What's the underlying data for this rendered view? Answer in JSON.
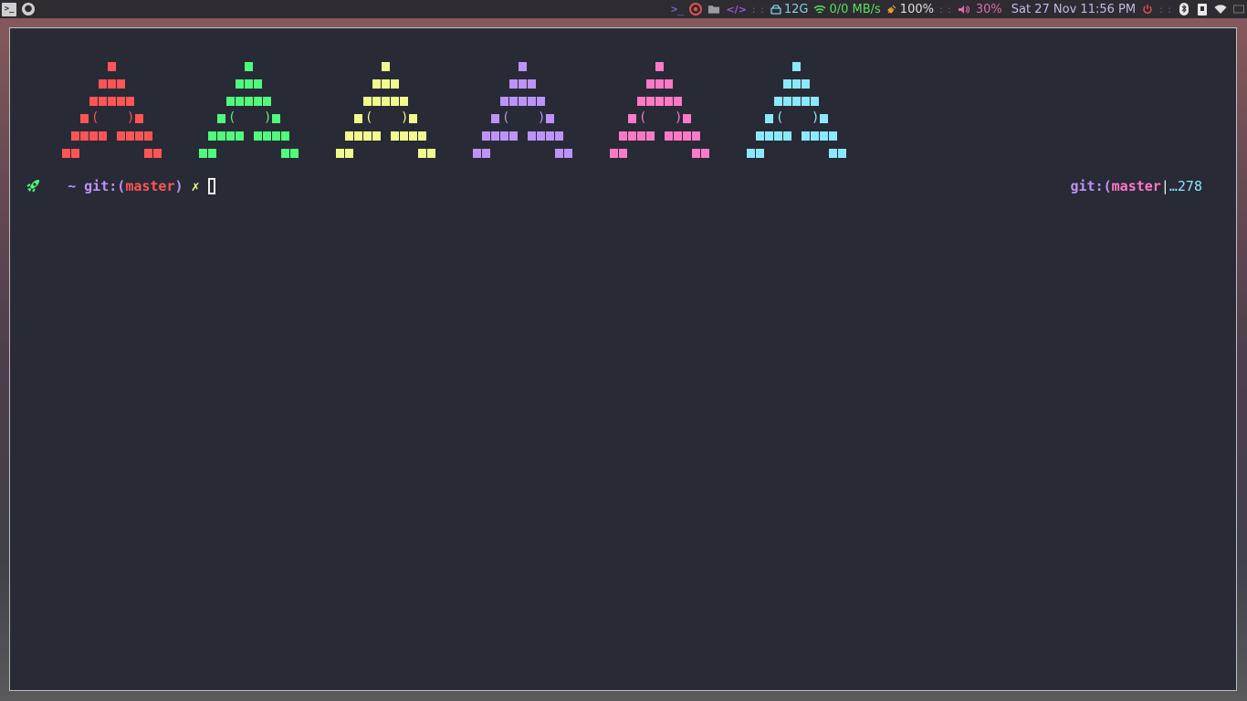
{
  "topbar": {
    "left": {
      "terminal_icon": "terminal-icon",
      "app_icon": "firefox-icon"
    },
    "right": {
      "launchers": {
        "terminal": ">_",
        "chrome": "chrome-icon",
        "files": "folder-icon",
        "code": "</>"
      },
      "separators": [
        ": :",
        ": :",
        ": :",
        ": :"
      ],
      "disk": "12G",
      "network": "0/0 MB/s",
      "battery": "100%",
      "volume": "30%",
      "datetime": "Sat 27 Nov 11:56 PM",
      "tray": [
        "bluetooth-icon",
        "keepassxc-icon",
        "wifi-icon",
        "display-icon"
      ]
    },
    "colors": {
      "launcher_terminal": "#7a7ae6",
      "chrome": "#e05050",
      "code": "#9a5ad8",
      "disk": "#7fd6e6",
      "network": "#5be05b",
      "battery": "#e0e0e0",
      "volume": "#e06aa8",
      "datetime": "#c8b8e8",
      "power": "#e05050"
    }
  },
  "terminal": {
    "invaders": [
      {
        "color": "#ff5555"
      },
      {
        "color": "#50fa7b"
      },
      {
        "color": "#f1fa8c"
      },
      {
        "color": "#bd93f9"
      },
      {
        "color": "#ff79c6"
      },
      {
        "color": "#8be9fd"
      }
    ],
    "eye_left": "(",
    "eye_right": ")",
    "prompt": {
      "symbol_icon": "rocket-icon",
      "tilde": "~",
      "git_label": "git:(",
      "branch": "master",
      "git_close": ")",
      "dirty_mark": "✗"
    },
    "right_prompt": {
      "git_label": "git:(",
      "branch": "master",
      "pipe": "|",
      "count": "…278"
    },
    "colors": {
      "background": "#282a36",
      "prompt_icon": "#50fa7b",
      "tilde": "#bd93f9",
      "git": "#bd93f9",
      "branch": "#ff5555",
      "dirty": "#f1fa8c",
      "rbranch": "#ff79c6",
      "count": "#8be9fd"
    }
  }
}
